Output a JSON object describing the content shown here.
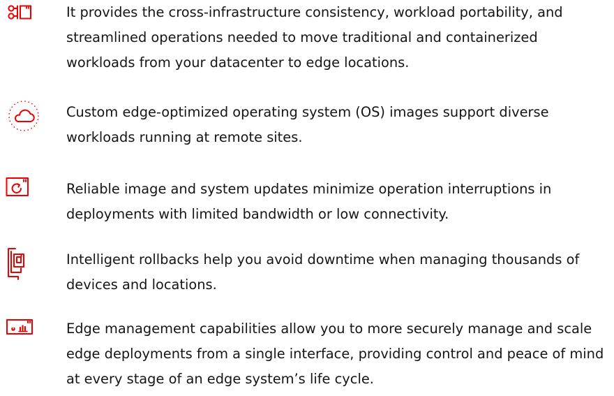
{
  "theme": {
    "accent_color": "#ee0000",
    "text_color": "#151515",
    "background": "#ffffff"
  },
  "features": [
    {
      "icon": "workload-portability-icon",
      "text": "It provides the cross-infrastructure consistency, workload portability, and streamlined operations needed to move traditional and containerized workloads from your datacenter to edge locations."
    },
    {
      "icon": "cloud-icon",
      "text": "Custom edge-optimized operating system (OS) images support diverse workloads running at remote sites."
    },
    {
      "icon": "refresh-update-icon",
      "text": "Reliable image and system updates minimize operation interruptions in deployments with limited bandwidth or low connectivity."
    },
    {
      "icon": "rollback-copy-icon",
      "text": "Intelligent rollbacks help you avoid downtime when managing thousands of devices and locations."
    },
    {
      "icon": "management-dashboard-icon",
      "text": "Edge management capabilities allow you to more securely manage and scale edge deployments from a single interface, providing control and peace of mind at every stage of an edge system’s life cycle."
    }
  ]
}
